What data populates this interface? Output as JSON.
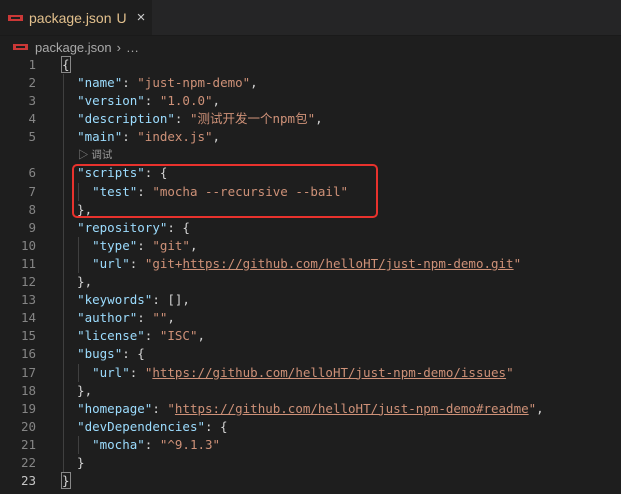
{
  "tab": {
    "title": "package.json",
    "badge": "U",
    "close": "×"
  },
  "breadcrumb": {
    "file": "package.json",
    "sep": "›",
    "more": "…"
  },
  "codelens": {
    "label": "▷ 调试"
  },
  "lines": [
    {
      "n": "1",
      "tokens": [
        [
          "p",
          "{"
        ]
      ]
    },
    {
      "n": "2",
      "tokens": [
        [
          "p",
          "  "
        ],
        [
          "k",
          "\"name\""
        ],
        [
          "p",
          ": "
        ],
        [
          "s",
          "\"just-npm-demo\""
        ],
        [
          "p",
          ","
        ]
      ]
    },
    {
      "n": "3",
      "tokens": [
        [
          "p",
          "  "
        ],
        [
          "k",
          "\"version\""
        ],
        [
          "p",
          ": "
        ],
        [
          "s",
          "\"1.0.0\""
        ],
        [
          "p",
          ","
        ]
      ]
    },
    {
      "n": "4",
      "tokens": [
        [
          "p",
          "  "
        ],
        [
          "k",
          "\"description\""
        ],
        [
          "p",
          ": "
        ],
        [
          "s",
          "\"测试开发一个npm包\""
        ],
        [
          "p",
          ","
        ]
      ]
    },
    {
      "n": "5",
      "tokens": [
        [
          "p",
          "  "
        ],
        [
          "k",
          "\"main\""
        ],
        [
          "p",
          ": "
        ],
        [
          "s",
          "\"index.js\""
        ],
        [
          "p",
          ","
        ]
      ]
    },
    {
      "n": "6",
      "tokens": [
        [
          "p",
          "  "
        ],
        [
          "k",
          "\"scripts\""
        ],
        [
          "p",
          ": {"
        ]
      ]
    },
    {
      "n": "7",
      "tokens": [
        [
          "p",
          "    "
        ],
        [
          "k",
          "\"test\""
        ],
        [
          "p",
          ": "
        ],
        [
          "s",
          "\"mocha --recursive --bail\""
        ]
      ]
    },
    {
      "n": "8",
      "tokens": [
        [
          "p",
          "  },"
        ]
      ]
    },
    {
      "n": "9",
      "tokens": [
        [
          "p",
          "  "
        ],
        [
          "k",
          "\"repository\""
        ],
        [
          "p",
          ": {"
        ]
      ]
    },
    {
      "n": "10",
      "tokens": [
        [
          "p",
          "    "
        ],
        [
          "k",
          "\"type\""
        ],
        [
          "p",
          ": "
        ],
        [
          "s",
          "\"git\""
        ],
        [
          "p",
          ","
        ]
      ]
    },
    {
      "n": "11",
      "tokens": [
        [
          "p",
          "    "
        ],
        [
          "k",
          "\"url\""
        ],
        [
          "p",
          ": "
        ],
        [
          "s",
          "\"git+"
        ],
        [
          "su",
          "https://github.com/helloHT/just-npm-demo.git"
        ],
        [
          "s",
          "\""
        ]
      ]
    },
    {
      "n": "12",
      "tokens": [
        [
          "p",
          "  },"
        ]
      ]
    },
    {
      "n": "13",
      "tokens": [
        [
          "p",
          "  "
        ],
        [
          "k",
          "\"keywords\""
        ],
        [
          "p",
          ": [],"
        ]
      ]
    },
    {
      "n": "14",
      "tokens": [
        [
          "p",
          "  "
        ],
        [
          "k",
          "\"author\""
        ],
        [
          "p",
          ": "
        ],
        [
          "s",
          "\"\""
        ],
        [
          "p",
          ","
        ]
      ]
    },
    {
      "n": "15",
      "tokens": [
        [
          "p",
          "  "
        ],
        [
          "k",
          "\"license\""
        ],
        [
          "p",
          ": "
        ],
        [
          "s",
          "\"ISC\""
        ],
        [
          "p",
          ","
        ]
      ]
    },
    {
      "n": "16",
      "tokens": [
        [
          "p",
          "  "
        ],
        [
          "k",
          "\"bugs\""
        ],
        [
          "p",
          ": {"
        ]
      ]
    },
    {
      "n": "17",
      "tokens": [
        [
          "p",
          "    "
        ],
        [
          "k",
          "\"url\""
        ],
        [
          "p",
          ": "
        ],
        [
          "s",
          "\""
        ],
        [
          "su",
          "https://github.com/helloHT/just-npm-demo/issues"
        ],
        [
          "s",
          "\""
        ]
      ]
    },
    {
      "n": "18",
      "tokens": [
        [
          "p",
          "  },"
        ]
      ]
    },
    {
      "n": "19",
      "tokens": [
        [
          "p",
          "  "
        ],
        [
          "k",
          "\"homepage\""
        ],
        [
          "p",
          ": "
        ],
        [
          "s",
          "\""
        ],
        [
          "su",
          "https://github.com/helloHT/just-npm-demo#readme"
        ],
        [
          "s",
          "\""
        ],
        [
          "p",
          ","
        ]
      ]
    },
    {
      "n": "20",
      "tokens": [
        [
          "p",
          "  "
        ],
        [
          "k",
          "\"devDependencies\""
        ],
        [
          "p",
          ": {"
        ]
      ]
    },
    {
      "n": "21",
      "tokens": [
        [
          "p",
          "    "
        ],
        [
          "k",
          "\"mocha\""
        ],
        [
          "p",
          ": "
        ],
        [
          "s",
          "\"^9.1.3\""
        ]
      ]
    },
    {
      "n": "22",
      "tokens": [
        [
          "p",
          "  }"
        ]
      ]
    },
    {
      "n": "23",
      "tokens": [
        [
          "p",
          "}"
        ]
      ]
    }
  ],
  "colors": {
    "key": "#9cdcfe",
    "string": "#ce9178",
    "punct": "#d4d4d4",
    "modified": "#e2c08d",
    "highlight": "#e8322d"
  }
}
